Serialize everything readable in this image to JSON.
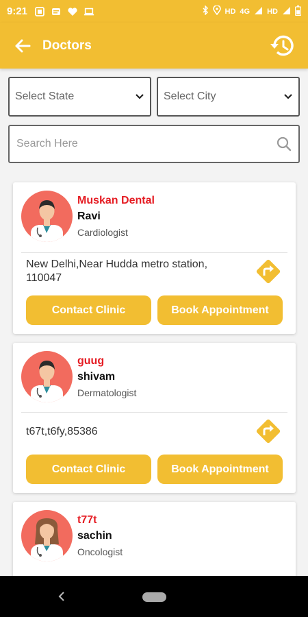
{
  "status_bar": {
    "time": "9:21",
    "network_hd1": "HD",
    "network_4g": "4G",
    "network_hd2": "HD"
  },
  "app_bar": {
    "title": "Doctors"
  },
  "filters": {
    "state_label": "Select State",
    "city_label": "Select City"
  },
  "search": {
    "placeholder": "Search Here",
    "value": ""
  },
  "doctors": [
    {
      "clinic": "Muskan Dental",
      "name": "Ravi",
      "specialty": "Cardiologist",
      "address": "New Delhi,Near Hudda metro station, 110047",
      "contact_label": "Contact Clinic",
      "book_label": "Book Appointment",
      "avatar": "male-doctor"
    },
    {
      "clinic": "guug",
      "name": "shivam",
      "specialty": "Dermatologist",
      "address": "t67t,t6fy,85386",
      "contact_label": "Contact Clinic",
      "book_label": "Book Appointment",
      "avatar": "male-doctor"
    },
    {
      "clinic": "t77t",
      "name": "sachin",
      "specialty": "Oncologist",
      "address": "",
      "contact_label": "",
      "book_label": "",
      "avatar": "female-doctor"
    }
  ],
  "colors": {
    "accent": "#f2be32",
    "clinic_name": "#e51c23",
    "avatar_bg": "#f26b5e"
  }
}
